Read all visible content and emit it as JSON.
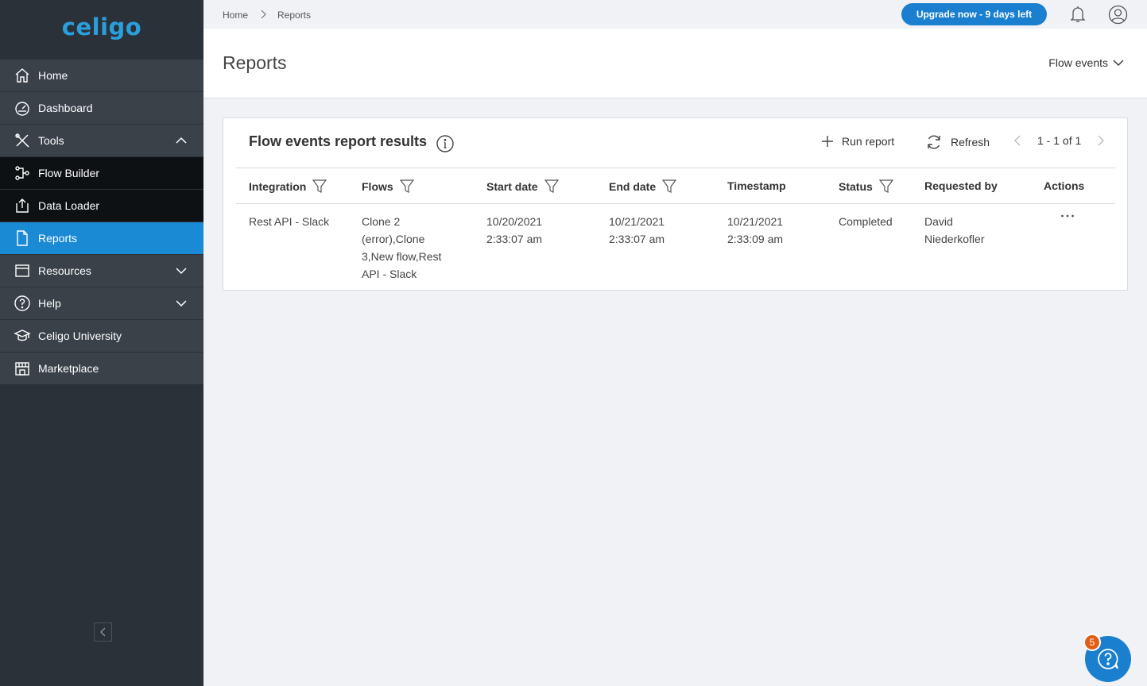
{
  "brand": {
    "logo": "celigo"
  },
  "sidebar": {
    "items": [
      {
        "label": "Home",
        "icon": "home-icon"
      },
      {
        "label": "Dashboard",
        "icon": "dashboard-icon"
      },
      {
        "label": "Tools",
        "icon": "tools-icon",
        "expanded": true
      },
      {
        "label": "Flow Builder",
        "icon": "flow-builder-icon"
      },
      {
        "label": "Data Loader",
        "icon": "data-loader-icon"
      },
      {
        "label": "Reports",
        "icon": "reports-icon",
        "active": true
      },
      {
        "label": "Resources",
        "icon": "resources-icon"
      },
      {
        "label": "Help",
        "icon": "help-icon"
      },
      {
        "label": "Celigo University",
        "icon": "university-icon"
      },
      {
        "label": "Marketplace",
        "icon": "marketplace-icon"
      }
    ]
  },
  "header": {
    "breadcrumb": [
      "Home",
      "Reports"
    ],
    "upgrade_label": "Upgrade now - 9 days left"
  },
  "page": {
    "title": "Reports",
    "report_type": "Flow events"
  },
  "card": {
    "title": "Flow events report results",
    "run_report_label": "Run report",
    "refresh_label": "Refresh",
    "pagination": "1 - 1 of 1"
  },
  "table": {
    "columns": [
      "Integration",
      "Flows",
      "Start date",
      "End date",
      "Timestamp",
      "Status",
      "Requested by",
      "Actions"
    ],
    "rows": [
      {
        "integration": "Rest API - Slack",
        "flows": [
          "Clone 2",
          "(error),Clone",
          "3,New flow,Rest",
          "API - Slack"
        ],
        "start_date": [
          "10/20/2021",
          "2:33:07 am"
        ],
        "end_date": [
          "10/21/2021",
          "2:33:07 am"
        ],
        "timestamp": [
          "10/21/2021",
          "2:33:09 am"
        ],
        "status": "Completed",
        "requested_by": [
          "David",
          "Niederkofler"
        ]
      }
    ]
  },
  "help_widget": {
    "badge_count": "5"
  },
  "colors": {
    "sidebar_bg": "#2b3138",
    "active": "#1a8ad4",
    "accent": "#1a7fcf",
    "badge": "#e35d16"
  }
}
